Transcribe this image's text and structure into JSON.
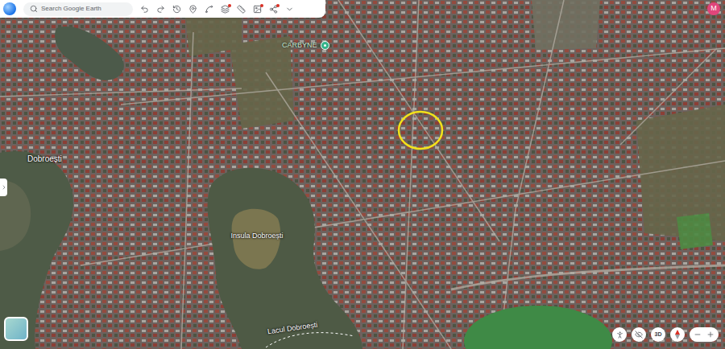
{
  "search": {
    "placeholder": "Search Google Earth"
  },
  "account": {
    "initial": "M"
  },
  "map_labels": [
    {
      "text": "CARBYNE",
      "kind": "place"
    },
    {
      "text": "Dobroești",
      "kind": "town"
    },
    {
      "text": "Insula Dobroești",
      "kind": "island"
    },
    {
      "text": "Lacul Dobroești",
      "kind": "lake"
    }
  ],
  "highlight_circle": {
    "visible": true
  },
  "view_controls": {
    "mode": "3D"
  }
}
